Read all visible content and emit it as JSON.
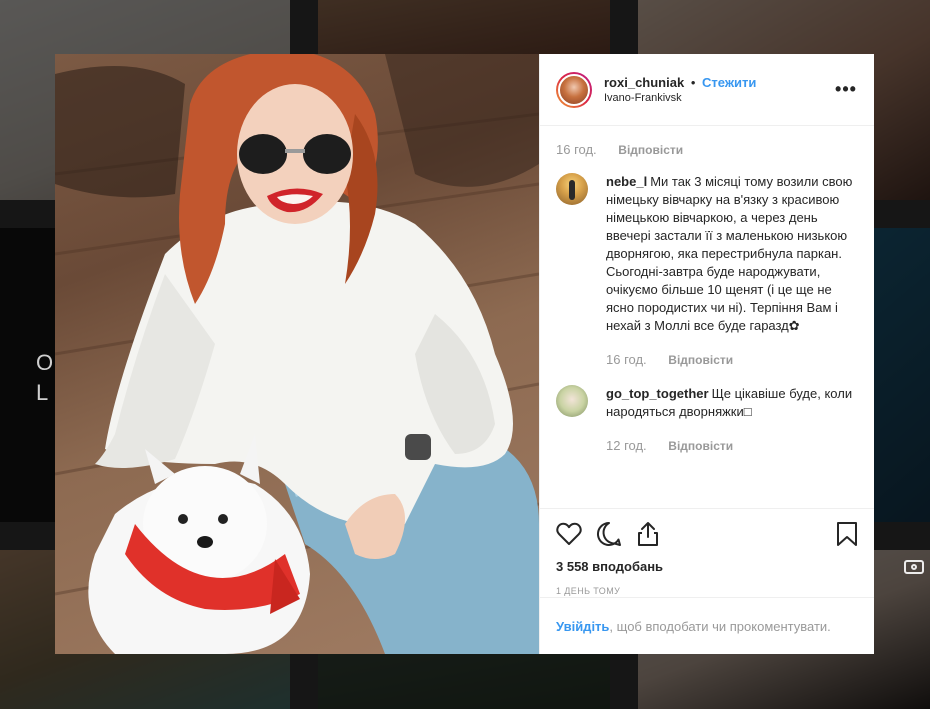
{
  "post": {
    "username": "roxi_chuniak",
    "separator": "•",
    "follow_label": "Стежити",
    "location": "Ivano-Frankivsk",
    "more_label": "•••"
  },
  "comments": {
    "first_meta": {
      "time": "16 год.",
      "reply": "Відповісти"
    },
    "items": [
      {
        "user": "nebe_l",
        "text": "Ми так 3 місяці тому возили свою німецьку вівчарку на в'язку з красивою німецькою вівчаркою, а через день ввечері застали її з маленькою низькою дворнягою, яка перестрибнула паркан. Сьогодні-завтра буде народжувати, очікуємо більше 10 щенят (і це ще не ясно породистих чи ні). Терпіння Вам і нехай з Моллі все буде гаразд✿",
        "time": "16 год.",
        "reply": "Відповісти"
      },
      {
        "user": "go_top_together",
        "text": "Ще цікавіше буде, коли народяться дворняжки□",
        "time": "12 год.",
        "reply": "Відповісти"
      }
    ]
  },
  "actions": {
    "icons": [
      "heart-icon",
      "comment-icon",
      "share-icon",
      "bookmark-icon"
    ],
    "likes_text": "3 558 вподобань",
    "date_text": "1 ДЕНЬ ТОМУ"
  },
  "login": {
    "link_label": "Увійдіть",
    "rest_text": ", щоб вподобати чи прокоментувати."
  },
  "background": {
    "tile_letters": "O\nL"
  },
  "colors": {
    "link": "#3897f0",
    "text": "#262626",
    "muted": "#999999",
    "lips": "#d0242a",
    "bandana": "#e0312a"
  }
}
